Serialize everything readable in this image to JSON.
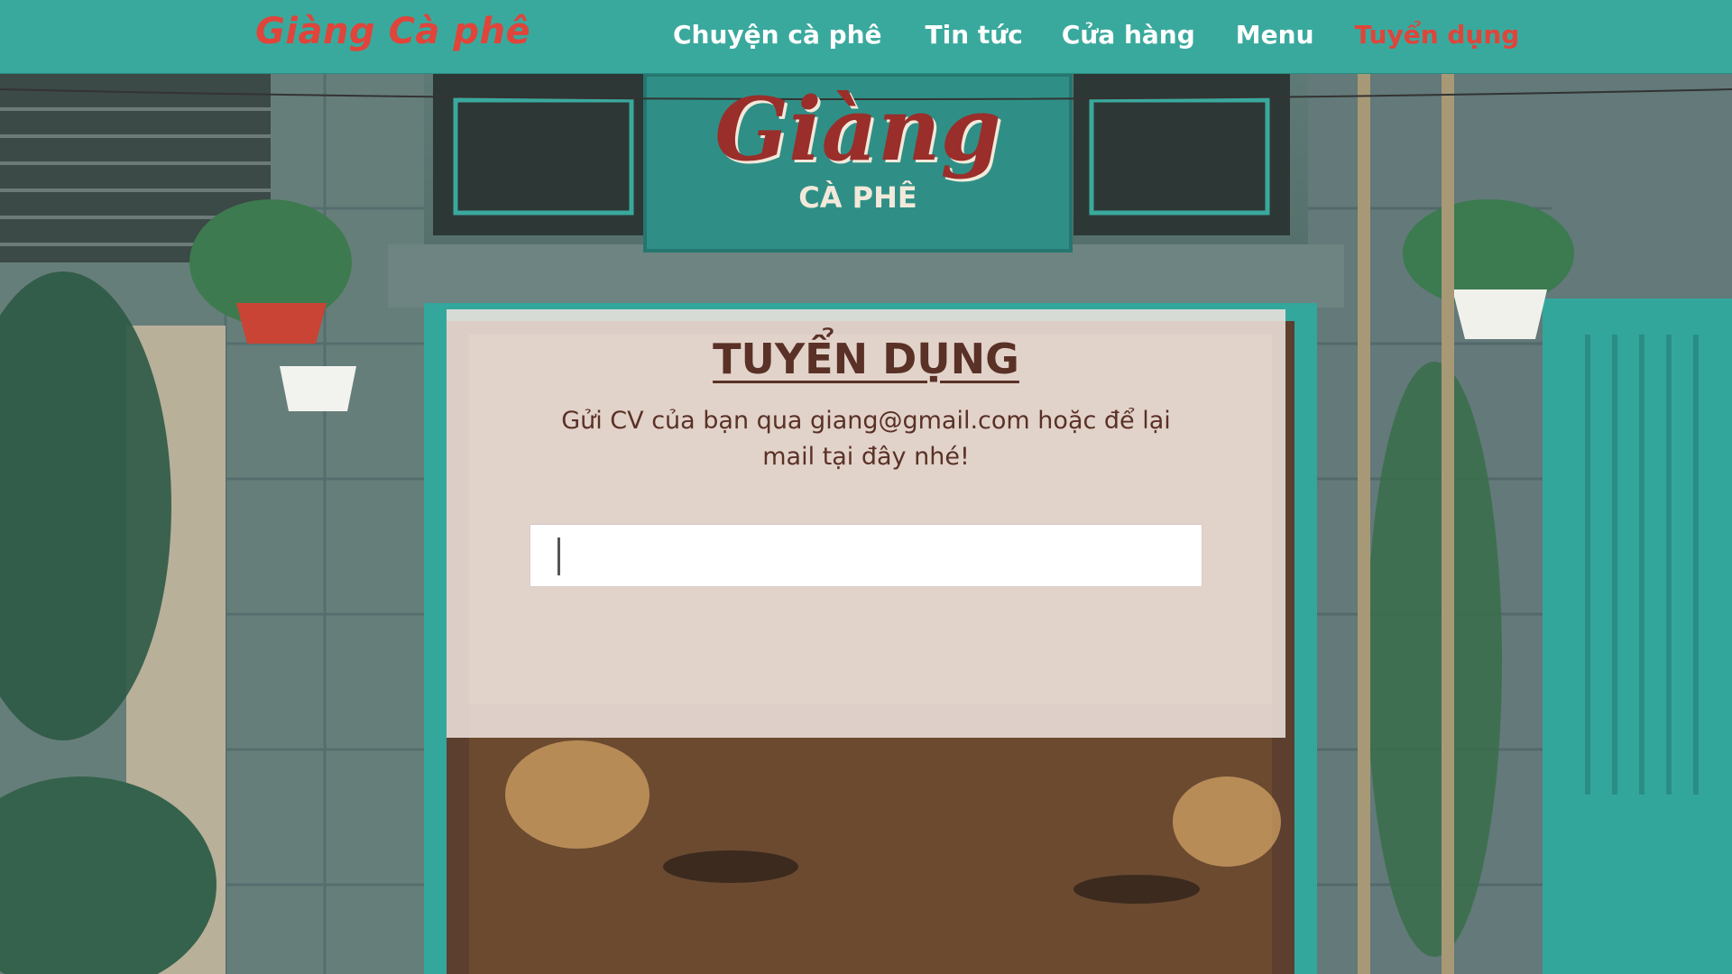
{
  "brand": {
    "name": "Giàng Cà phê",
    "color": "#e0443a"
  },
  "nav": {
    "background": "#3aa99d",
    "items": [
      {
        "label": "Chuyện cà phê",
        "active": false
      },
      {
        "label": "Tin tức",
        "active": false
      },
      {
        "label": "Cửa hàng",
        "active": false
      },
      {
        "label": "Menu",
        "active": false
      },
      {
        "label": "Tuyển dụng",
        "active": true
      }
    ]
  },
  "hero": {
    "sign_title": "Giàng",
    "sign_subtitle": "CÀ PHÊ"
  },
  "recruit": {
    "title": "TUYỂN DỤNG",
    "message": "Gửi CV của bạn qua giang@gmail.com hoặc để lại mail tại đây nhé!",
    "input_value": "",
    "input_placeholder": ""
  }
}
